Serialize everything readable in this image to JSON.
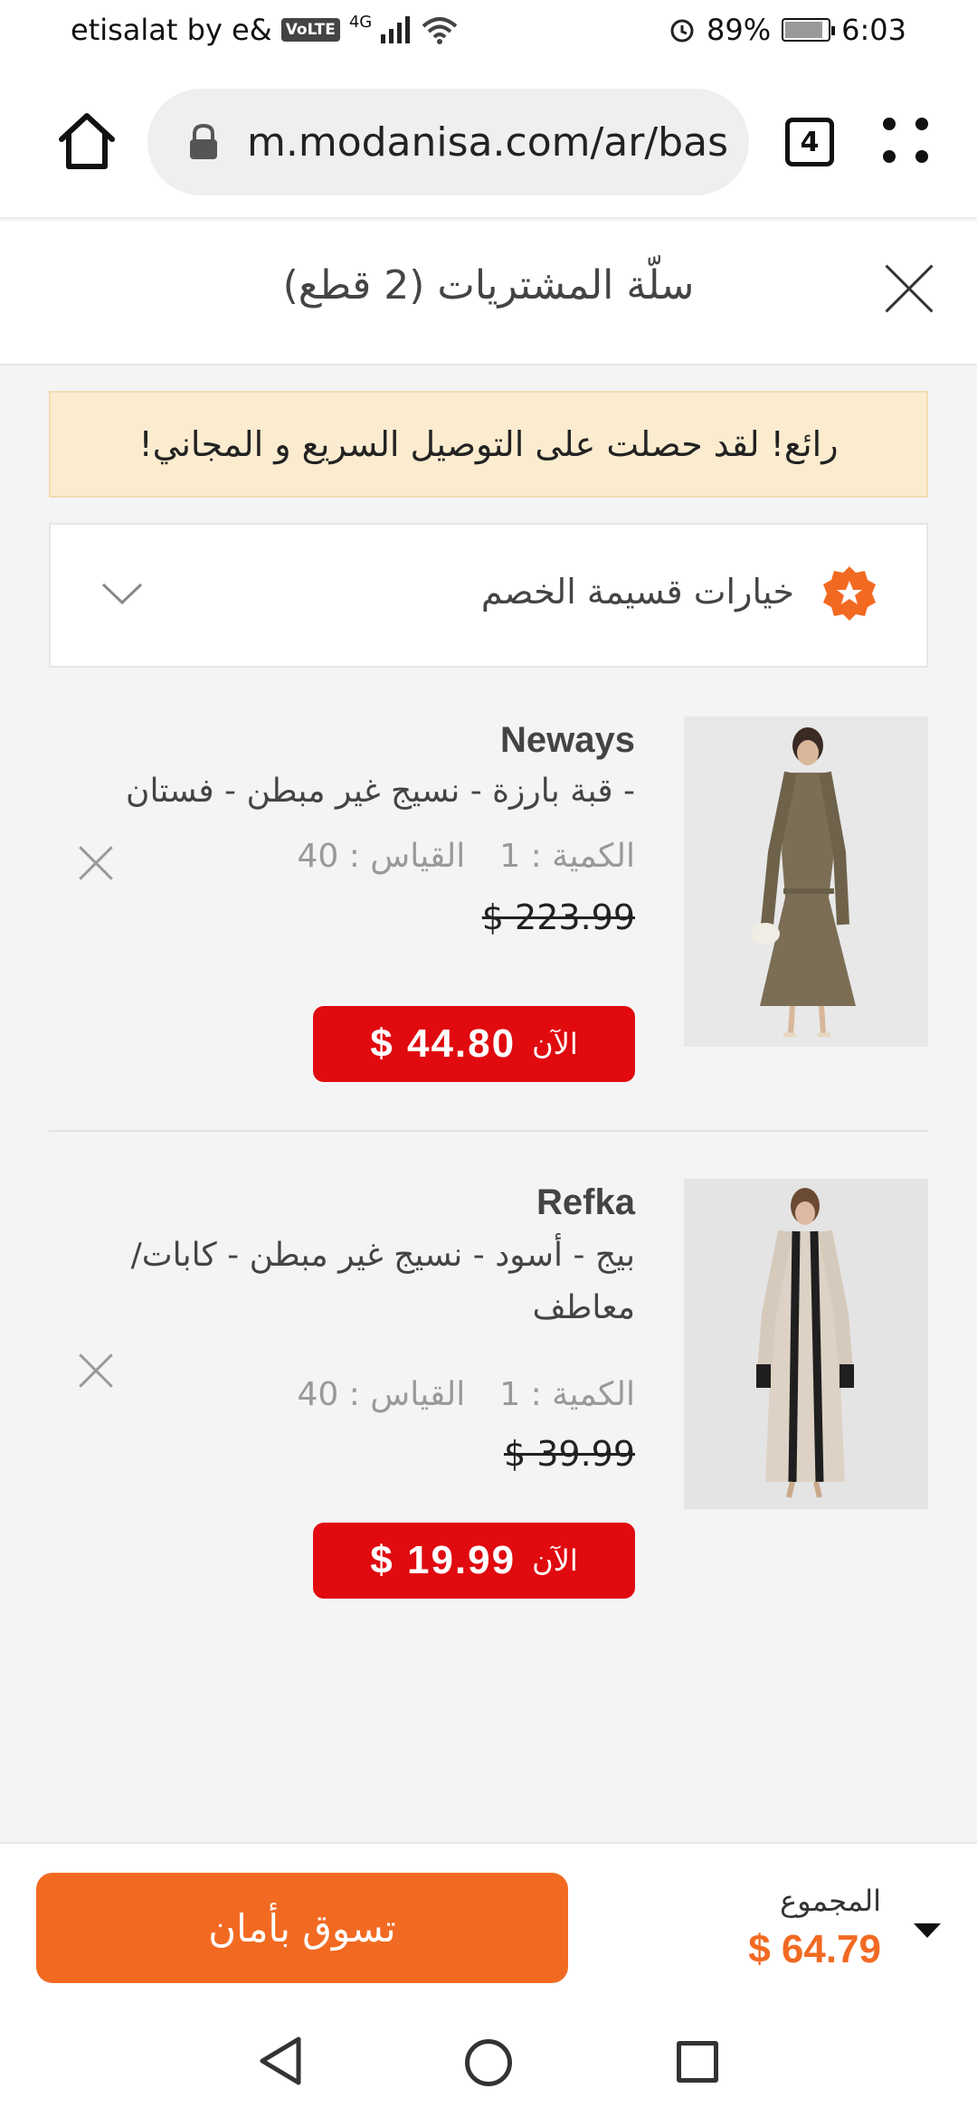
{
  "status_bar": {
    "carrier": "etisalat by e&",
    "volte": "VoLTE",
    "network": "4G",
    "battery": "89%",
    "battery_level": 0.89,
    "time": "6:03"
  },
  "browser": {
    "url": "m.modanisa.com/ar/bas",
    "tab_count": "4"
  },
  "cart": {
    "title": "سلّة المشتريات (2 قطع)",
    "banner": "رائع! لقد حصلت على التوصيل السريع و المجاني!",
    "discount_label": "خيارات قسيمة الخصم",
    "items": [
      {
        "brand": "Neways",
        "name": "- قبة بارزة - نسيج غير مبطن - فستان",
        "quantity_label": "الكمية : 1",
        "size_label": "القياس : 40",
        "old_price": "$ 223.99",
        "now_label": "الآن",
        "price": "$ 44.80",
        "image_colors": {
          "background": "#e8e8e8",
          "garment": "#7b6e55"
        }
      },
      {
        "brand": "Refka",
        "name": "بيج - أسود - نسيج غير مبطن - كابات/ معاطف",
        "quantity_label": "الكمية : 1",
        "size_label": "القياس : 40",
        "old_price": "$ 39.99",
        "now_label": "الآن",
        "price": "$ 19.99",
        "image_colors": {
          "background": "#e4e4e4",
          "garment": "#ddd2c5",
          "trim": "#1f1f1f"
        }
      }
    ]
  },
  "footer": {
    "total_label": "المجموع",
    "total": "$ 64.79",
    "checkout_label": "تسوق بأمان"
  },
  "colors": {
    "accent": "#f26a22",
    "price_red": "#e00a0f",
    "banner_bg": "#fbeccf"
  }
}
